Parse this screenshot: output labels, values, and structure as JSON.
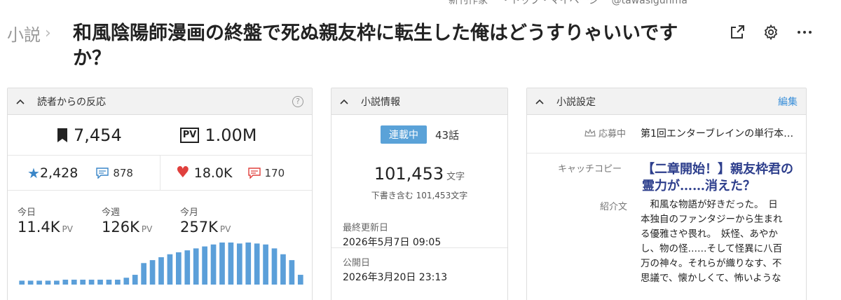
{
  "topbar": [
    "新刊作家",
    "・トップ・マイページ",
    "@tawasigunma"
  ],
  "breadcrumb": {
    "label": "小説"
  },
  "title": "和風陰陽師漫画の終盤で死ぬ親友枠に転生した俺はどうすりゃいいですか？",
  "reactions": {
    "header": "読者からの反応",
    "help": "?",
    "bookmarks": "7,454",
    "pv_badge": "PV",
    "pv_total": "1.00M",
    "stars": "2,428",
    "star_reviews": "878",
    "hearts": "18.0K",
    "heart_comments": "170",
    "periods": [
      {
        "label": "今日",
        "value": "11.4K",
        "unit": "PV"
      },
      {
        "label": "今週",
        "value": "126K",
        "unit": "PV"
      },
      {
        "label": "今月",
        "value": "257K",
        "unit": "PV"
      }
    ]
  },
  "chart_data": {
    "type": "bar",
    "values": [
      4,
      4,
      4,
      4,
      4,
      5,
      5,
      5,
      5,
      5,
      5,
      5,
      7,
      10,
      22,
      25,
      28,
      31,
      33,
      35,
      37,
      39,
      41,
      43,
      43,
      42,
      43,
      42,
      41,
      37,
      31,
      25,
      10
    ],
    "color": "#5b9fd9"
  },
  "info": {
    "header": "小説情報",
    "status": "連載中",
    "episodes": "43話",
    "chars": "101,453",
    "chars_unit": "文字",
    "chars_sub": "下書き含む 101,453文字",
    "updated_label": "最終更新日",
    "updated": "2026年5月7日 09:05",
    "published_label": "公開日",
    "published": "2026年3月20日 23:13"
  },
  "settings": {
    "header": "小説設定",
    "edit": "編集",
    "contest_label": "応募中",
    "contest": "第1回エンターブレインの単行本…",
    "catch_label": "キャッチコピー",
    "catch_line1": "【二章開始！】親友枠君の",
    "catch_line2": "霊力が……消えた？",
    "intro_label": "紹介文",
    "intro_lines": [
      "　和風な物語が好きだった。　日",
      "本独自のファンタジーから生まれ",
      "る優雅さや畏れ。　妖怪、あやか",
      "し、物の怪……そして怪異に八百",
      "万の神々。それらが織りなす、不",
      "思議で、懐かしくて、怖いような"
    ]
  }
}
